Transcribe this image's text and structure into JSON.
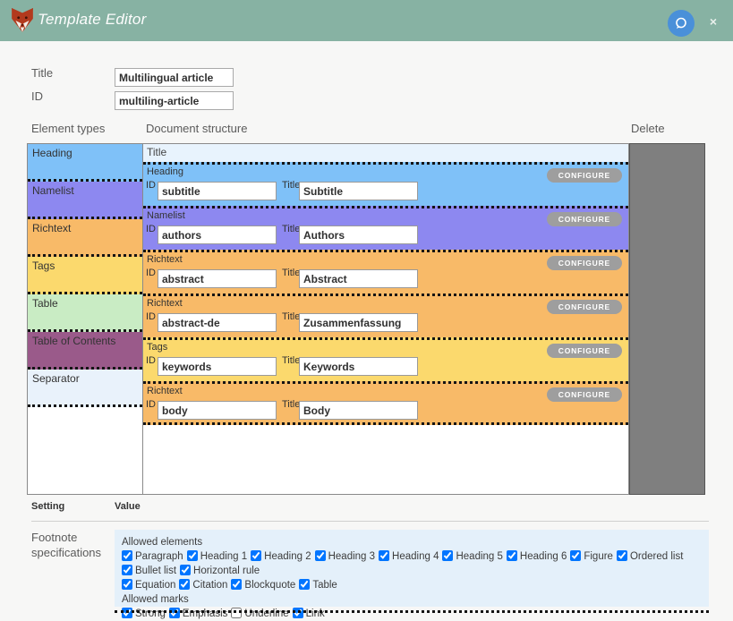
{
  "header": {
    "title": "Template Editor",
    "close_label": "×",
    "bg_color": "#87b2a3",
    "chat_button_color": "#4a90d9",
    "logo": "fox-icon",
    "chat_icon": "speech-bubble-icon"
  },
  "form": {
    "title_label": "Title",
    "title_value": "Multilingual article",
    "id_label": "ID",
    "id_value": "multiling-article"
  },
  "columns": {
    "element_types": "Element types",
    "document_structure": "Document structure",
    "delete": "Delete"
  },
  "element_types": [
    {
      "label": "Heading",
      "color": "#7fc1f8"
    },
    {
      "label": "Namelist",
      "color": "#8d88f0"
    },
    {
      "label": "Richtext",
      "color": "#f8ba68"
    },
    {
      "label": "Tags",
      "color": "#fbd96d"
    },
    {
      "label": "Table",
      "color": "#c9ecc4"
    },
    {
      "label": "Table of Contents",
      "color": "#9a5a8a"
    },
    {
      "label": "Separator",
      "color": "#e9f2fb"
    }
  ],
  "document_structure": {
    "title_bar_label": "Title",
    "id_field_label": "ID",
    "title_field_label": "Title",
    "configure_label": "CONFIGURE",
    "blocks": [
      {
        "type": "Heading",
        "id": "subtitle",
        "title": "Subtitle",
        "color": "#7fc1f8"
      },
      {
        "type": "Namelist",
        "id": "authors",
        "title": "Authors",
        "color": "#8d88f0"
      },
      {
        "type": "Richtext",
        "id": "abstract",
        "title": "Abstract",
        "color": "#f8ba68"
      },
      {
        "type": "Richtext",
        "id": "abstract-de",
        "title": "Zusammenfassung",
        "color": "#f8ba68"
      },
      {
        "type": "Tags",
        "id": "keywords",
        "title": "Keywords",
        "color": "#fbd96d"
      },
      {
        "type": "Richtext",
        "id": "body",
        "title": "Body",
        "color": "#f8ba68"
      }
    ]
  },
  "settings": {
    "setting_header": "Setting",
    "value_header": "Value",
    "row_label": "Footnote specifications",
    "allowed_elements_label": "Allowed elements",
    "allowed_marks_label": "Allowed marks",
    "allowed_elements": [
      {
        "label": "Paragraph",
        "checked": true
      },
      {
        "label": "Heading 1",
        "checked": true
      },
      {
        "label": "Heading 2",
        "checked": true
      },
      {
        "label": "Heading 3",
        "checked": true
      },
      {
        "label": "Heading 4",
        "checked": true
      },
      {
        "label": "Heading 5",
        "checked": true
      },
      {
        "label": "Heading 6",
        "checked": true
      },
      {
        "label": "Figure",
        "checked": true
      },
      {
        "label": "Ordered list",
        "checked": true
      },
      {
        "label": "Bullet list",
        "checked": true
      },
      {
        "label": "Horizontal rule",
        "checked": true
      },
      {
        "label": "Equation",
        "checked": true
      },
      {
        "label": "Citation",
        "checked": true
      },
      {
        "label": "Blockquote",
        "checked": true
      },
      {
        "label": "Table",
        "checked": true
      }
    ],
    "allowed_marks": [
      {
        "label": "Strong",
        "checked": true
      },
      {
        "label": "Emphasis",
        "checked": true
      },
      {
        "label": "Underline",
        "checked": false
      },
      {
        "label": "Link",
        "checked": true
      }
    ]
  }
}
